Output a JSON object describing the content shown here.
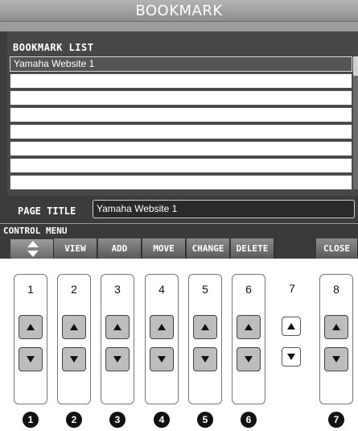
{
  "window": {
    "title": "BOOKMARK"
  },
  "list": {
    "label": "BOOKMARK LIST",
    "items": [
      "Yamaha Website 1",
      "",
      "",
      "",
      "",
      "",
      "",
      ""
    ]
  },
  "page_title": {
    "label": "PAGE TITLE",
    "value": "Yamaha Website 1"
  },
  "control_menu": {
    "label": "CONTROL MENU",
    "buttons": [
      "VIEW",
      "ADD",
      "MOVE",
      "CHANGE",
      "DELETE",
      "CLOSE"
    ]
  },
  "panel_buttons": {
    "numbers": [
      "1",
      "2",
      "3",
      "4",
      "5",
      "6",
      "7",
      "8"
    ],
    "callouts": [
      "1",
      "2",
      "3",
      "4",
      "5",
      "6",
      "7"
    ]
  }
}
